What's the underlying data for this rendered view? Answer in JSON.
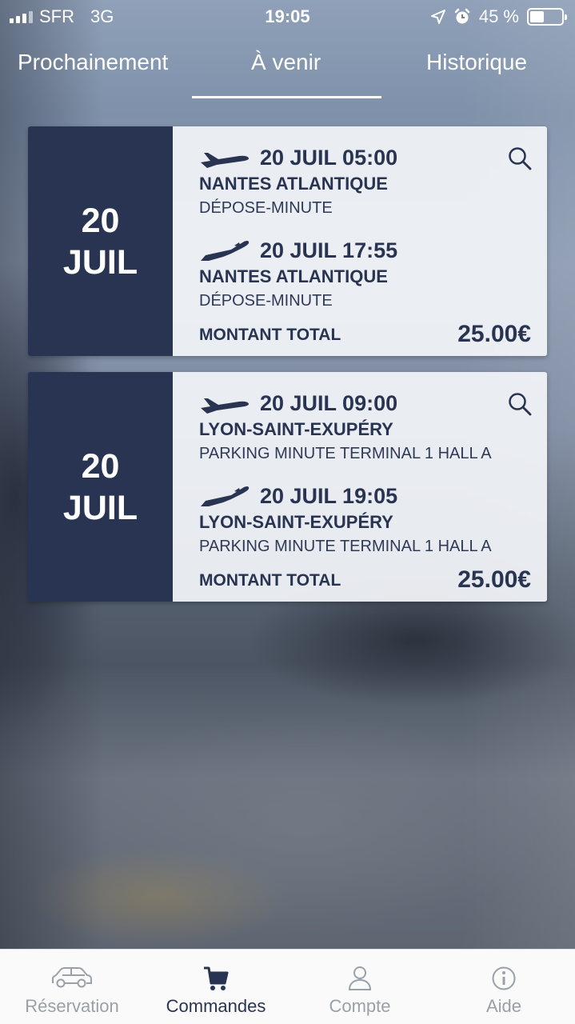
{
  "status_bar": {
    "carrier": "SFR",
    "network": "3G",
    "time": "19:05",
    "battery": "45 %"
  },
  "tabs": [
    {
      "label": "Prochainement",
      "active": false
    },
    {
      "label": "À venir",
      "active": true
    },
    {
      "label": "Historique",
      "active": false
    }
  ],
  "reservations": [
    {
      "day": "20",
      "month": "JUIL",
      "outbound": {
        "datetime": "20 JUIL 05:00",
        "place": "NANTES ATLANTIQUE",
        "detail": "DÉPOSE-MINUTE"
      },
      "return": {
        "datetime": "20 JUIL 17:55",
        "place": "NANTES ATLANTIQUE",
        "detail": "DÉPOSE-MINUTE"
      },
      "total_label": "MONTANT TOTAL",
      "total": "25.00€"
    },
    {
      "day": "20",
      "month": "JUIL",
      "outbound": {
        "datetime": "20 JUIL 09:00",
        "place": "LYON-SAINT-EXUPÉRY",
        "detail": "PARKING MINUTE TERMINAL 1 HALL A"
      },
      "return": {
        "datetime": "20 JUIL 19:05",
        "place": "LYON-SAINT-EXUPÉRY",
        "detail": "PARKING MINUTE TERMINAL 1 HALL A"
      },
      "total_label": "MONTANT TOTAL",
      "total": "25.00€"
    }
  ],
  "bottom_nav": [
    {
      "label": "Réservation",
      "icon": "car-icon",
      "active": false
    },
    {
      "label": "Commandes",
      "icon": "cart-icon",
      "active": true
    },
    {
      "label": "Compte",
      "icon": "user-icon",
      "active": false
    },
    {
      "label": "Aide",
      "icon": "info-icon",
      "active": false
    }
  ],
  "colors": {
    "accent": "#283451",
    "inactive": "#9aa0a8",
    "card_bg": "#f2f4f8"
  }
}
